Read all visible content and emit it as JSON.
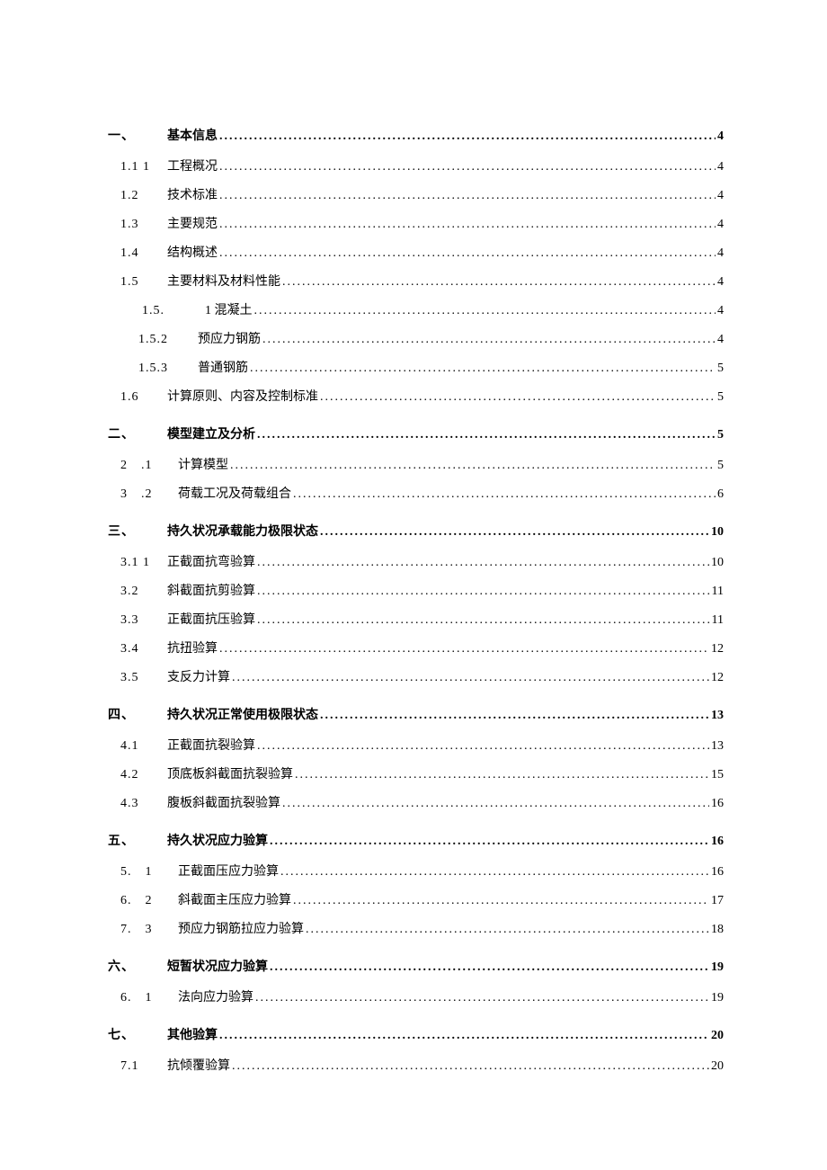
{
  "toc": [
    {
      "level": 1,
      "num": "一、",
      "title": "基本信息",
      "page": "4",
      "classes": "level-1 first-l1"
    },
    {
      "level": 2,
      "num": "1.1 1",
      "title": "工程概况",
      "page": "4",
      "classes": "level-2"
    },
    {
      "level": 2,
      "num": "1.2",
      "title": "技术标准",
      "page": "4",
      "classes": "level-2"
    },
    {
      "level": 2,
      "num": "1.3",
      "title": "主要规范",
      "page": "4",
      "classes": "level-2"
    },
    {
      "level": 2,
      "num": "1.4",
      "title": "结构概述",
      "page": "4",
      "classes": "level-2"
    },
    {
      "level": 2,
      "num": "1.5",
      "title": "主要材料及材料性能",
      "page": "4",
      "classes": "level-2"
    },
    {
      "level": 3,
      "num": "1.5.",
      "title": "1 混凝土",
      "page": "4",
      "classes": "level-3"
    },
    {
      "level": 3,
      "num": "1.5.2",
      "title": "预应力钢筋",
      "page": "4",
      "classes": "level-3 level-3b"
    },
    {
      "level": 3,
      "num": "1.5.3",
      "title": "普通钢筋",
      "page": "5",
      "classes": "level-3 level-3b"
    },
    {
      "level": 2,
      "num": "1.6",
      "title": "计算原则、内容及控制标准",
      "page": "5",
      "classes": "level-2"
    },
    {
      "level": 1,
      "num": "二、",
      "title": "模型建立及分析",
      "page": "5",
      "classes": "level-1"
    },
    {
      "level": 2,
      "num": "2 .1",
      "title": "计算模型",
      "page": "5",
      "classes": "level-2 level-2-wide"
    },
    {
      "level": 2,
      "num": "3 .2",
      "title": "荷载工况及荷载组合",
      "page": "6",
      "classes": "level-2 level-2-wide"
    },
    {
      "level": 1,
      "num": "三、",
      "title": "持久状况承载能力极限状态",
      "page": "10",
      "classes": "level-1"
    },
    {
      "level": 2,
      "num": "3.1 1",
      "title": "正截面抗弯验算",
      "page": "10",
      "classes": "level-2"
    },
    {
      "level": 2,
      "num": "3.2",
      "title": "斜截面抗剪验算",
      "page": "11",
      "classes": "level-2"
    },
    {
      "level": 2,
      "num": "3.3",
      "title": "正截面抗压验算",
      "page": "11",
      "classes": "level-2"
    },
    {
      "level": 2,
      "num": "3.4",
      "title": "抗扭验算",
      "page": "12",
      "classes": "level-2"
    },
    {
      "level": 2,
      "num": "3.5",
      "title": "支反力计算",
      "page": "12",
      "classes": "level-2"
    },
    {
      "level": 1,
      "num": "四、",
      "title": "持久状况正常使用极限状态",
      "page": "13",
      "classes": "level-1"
    },
    {
      "level": 2,
      "num": "4.1",
      "title": "正截面抗裂验算",
      "page": "13",
      "classes": "level-2"
    },
    {
      "level": 2,
      "num": "4.2",
      "title": "顶底板斜截面抗裂验算",
      "page": "15",
      "classes": "level-2"
    },
    {
      "level": 2,
      "num": "4.3",
      "title": "腹板斜截面抗裂验算",
      "page": "16",
      "classes": "level-2"
    },
    {
      "level": 1,
      "num": "五、",
      "title": "持久状况应力验算",
      "page": "16",
      "classes": "level-1"
    },
    {
      "level": 2,
      "num": "5. 1",
      "title": "正截面压应力验算",
      "page": "16",
      "classes": "level-2 level-2-wide"
    },
    {
      "level": 2,
      "num": "6. 2",
      "title": "斜截面主压应力验算",
      "page": "17",
      "classes": "level-2 level-2-wide"
    },
    {
      "level": 2,
      "num": "7. 3",
      "title": "预应力钢筋拉应力验算",
      "page": "18",
      "classes": "level-2 level-2-wide"
    },
    {
      "level": 1,
      "num": "六、",
      "title": "短暂状况应力验算",
      "page": "19",
      "classes": "level-1"
    },
    {
      "level": 2,
      "num": "6. 1",
      "title": "法向应力验算",
      "page": "19",
      "classes": "level-2 level-2-wide"
    },
    {
      "level": 1,
      "num": "七、",
      "title": "其他验算",
      "page": "20",
      "classes": "level-1"
    },
    {
      "level": 2,
      "num": "7.1",
      "title": "抗倾覆验算",
      "page": "20",
      "classes": "level-2"
    }
  ]
}
